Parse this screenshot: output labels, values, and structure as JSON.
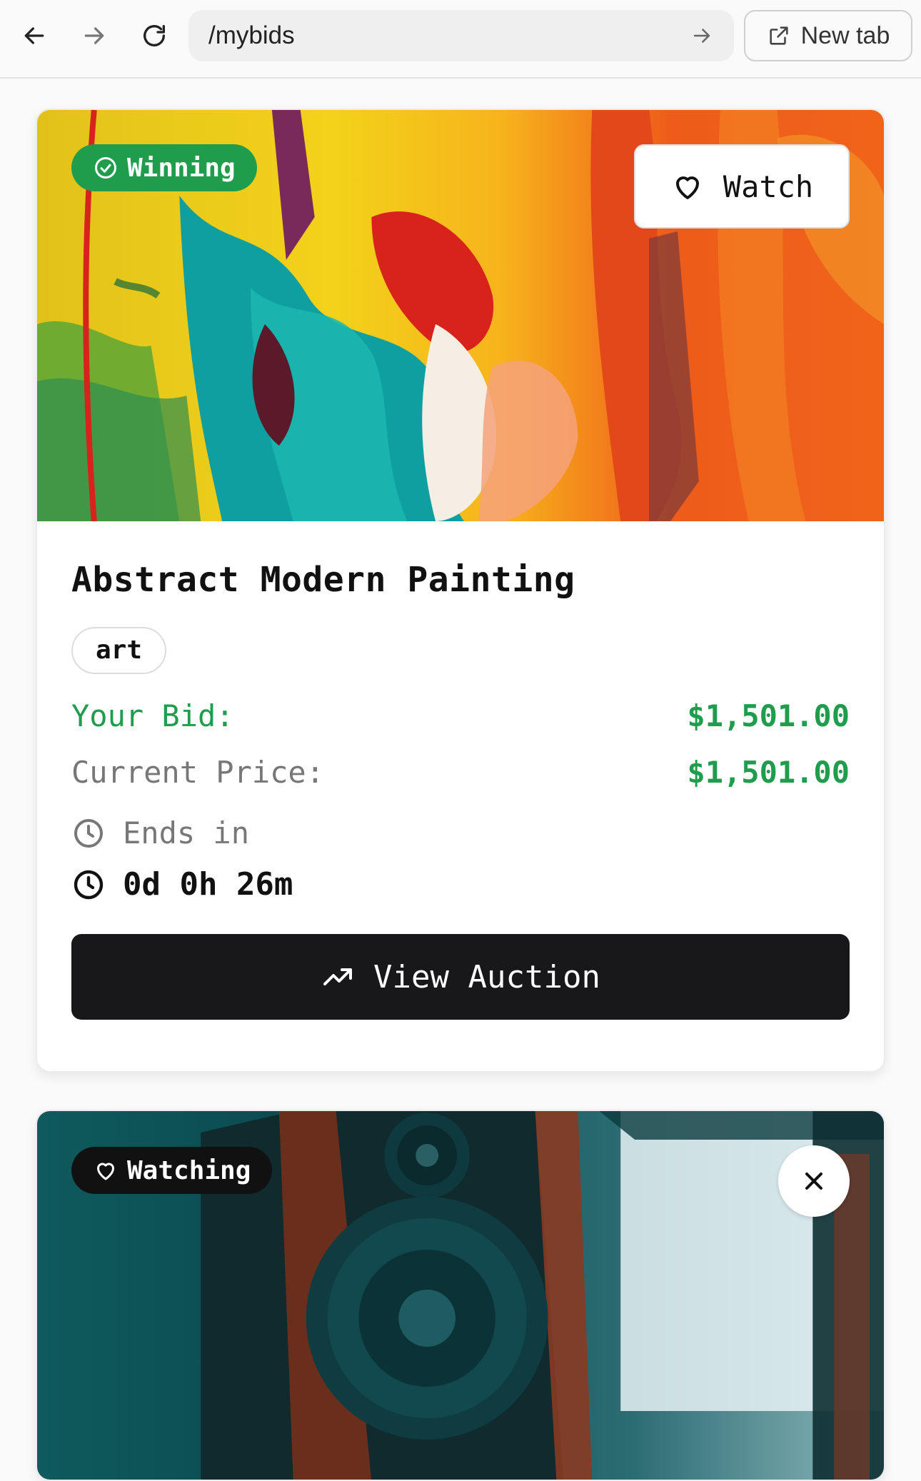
{
  "browser": {
    "url": "/mybids",
    "new_tab_label": "New tab"
  },
  "cards": [
    {
      "status_badge": "Winning",
      "watch_label": "Watch",
      "title": "Abstract Modern Painting",
      "tag": "art",
      "your_bid_label": "Your Bid:",
      "your_bid_value": "$1,501.00",
      "current_price_label": "Current Price:",
      "current_price_value": "$1,501.00",
      "ends_label": "Ends in",
      "time_left": "0d 0h 26m",
      "view_label": "View Auction"
    },
    {
      "status_badge": "Watching"
    }
  ],
  "colors": {
    "winning": "#1f9d4c",
    "price": "#1f9d4c",
    "button_dark": "#18181b"
  }
}
